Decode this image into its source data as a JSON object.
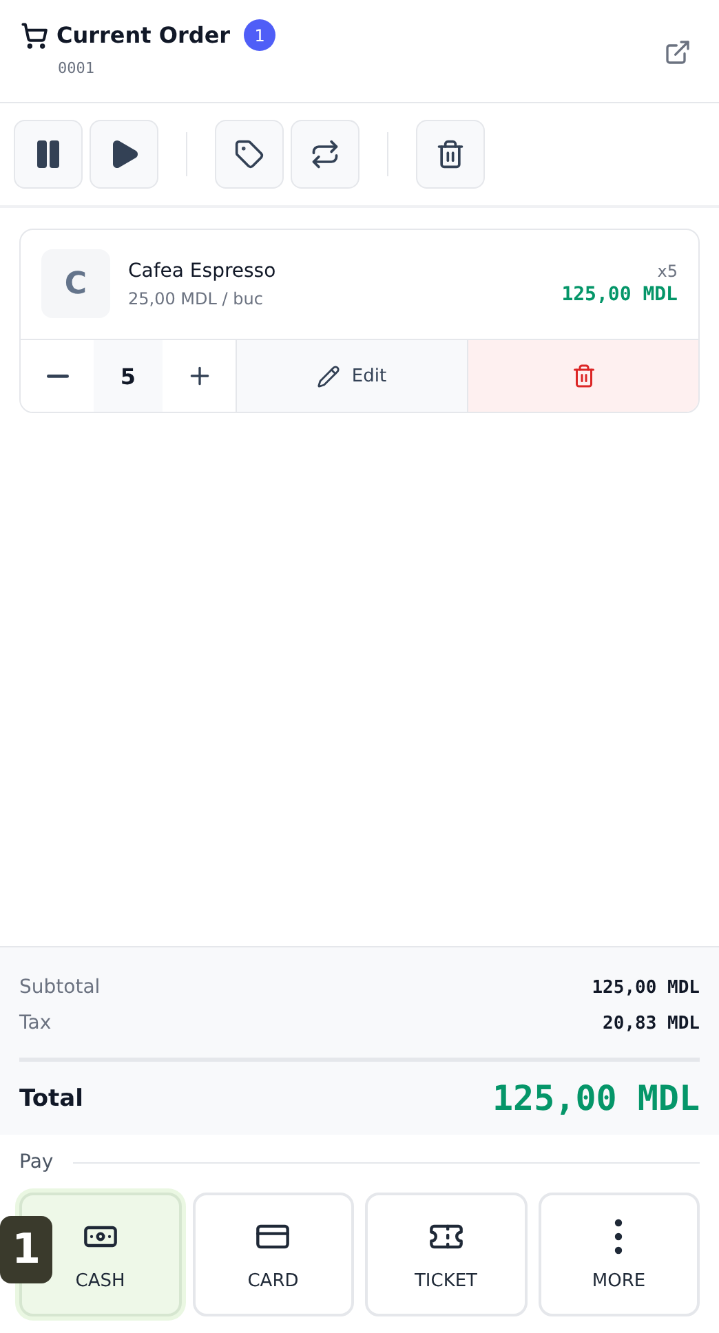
{
  "header": {
    "title": "Current Order",
    "count": "1",
    "order_number": "0001"
  },
  "items": [
    {
      "initial": "C",
      "name": "Cafea Espresso",
      "unit_price": "25,00 MDL / buc",
      "multiplier": "x5",
      "total": "125,00 MDL",
      "quantity": "5",
      "edit_label": "Edit"
    }
  ],
  "summary": {
    "rows": [
      {
        "label": "Subtotal",
        "value": "125,00 MDL"
      },
      {
        "label": "Tax",
        "value": "20,83 MDL"
      }
    ],
    "total_label": "Total",
    "total_value": "125,00 MDL"
  },
  "payment": {
    "heading": "Pay",
    "methods": [
      {
        "kind": "cash",
        "label": "CASH",
        "selected": true,
        "marker": "1"
      },
      {
        "kind": "card",
        "label": "CARD",
        "selected": false
      },
      {
        "kind": "ticket",
        "label": "TICKET",
        "selected": false
      },
      {
        "kind": "more",
        "label": "MORE",
        "selected": false
      }
    ]
  }
}
